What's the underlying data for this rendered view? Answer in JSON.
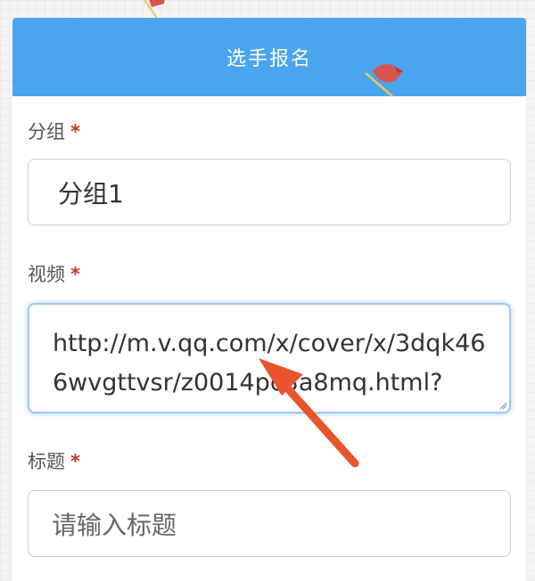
{
  "form": {
    "title": "选手报名",
    "required_mark": "*",
    "group": {
      "label": "分组",
      "value": "分组1"
    },
    "video": {
      "label": "视频",
      "value": "http://m.v.qq.com/x/cover/x/3dqk466wvgttvsr/z0014pc3a8mq.html?"
    },
    "title_field": {
      "label": "标题",
      "placeholder": "请输入标题"
    }
  },
  "colors": {
    "header": "#4aa4ee",
    "required": "#c0392b",
    "focus_border": "#9fc8f2",
    "annotation_arrow": "#e8552d"
  },
  "icons": [
    "flag-icon",
    "resize-handle-icon",
    "annotation-arrow"
  ]
}
